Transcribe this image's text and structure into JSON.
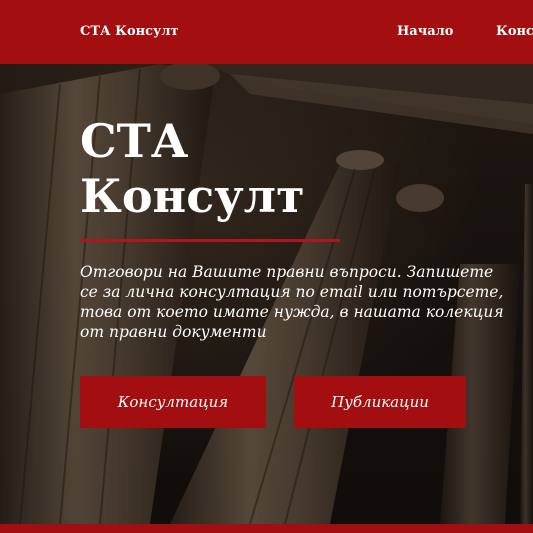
{
  "header": {
    "brand": "СТА Консулт",
    "nav": [
      "Начало",
      "Конс"
    ]
  },
  "hero": {
    "title_line1": "СТА",
    "title_line2": "Консулт",
    "lead": "Отговори на Вашите правни въпроси. Запишете се за лична консултация по email или потърсете, това от което имате нужда, в нашата колекция от правни документи",
    "buttons": {
      "consultation": "Консултация",
      "publications": "Публикации"
    },
    "background_image": "courthouse-columns"
  },
  "colors": {
    "accent": "#a30f10",
    "text": "#ffffff"
  }
}
